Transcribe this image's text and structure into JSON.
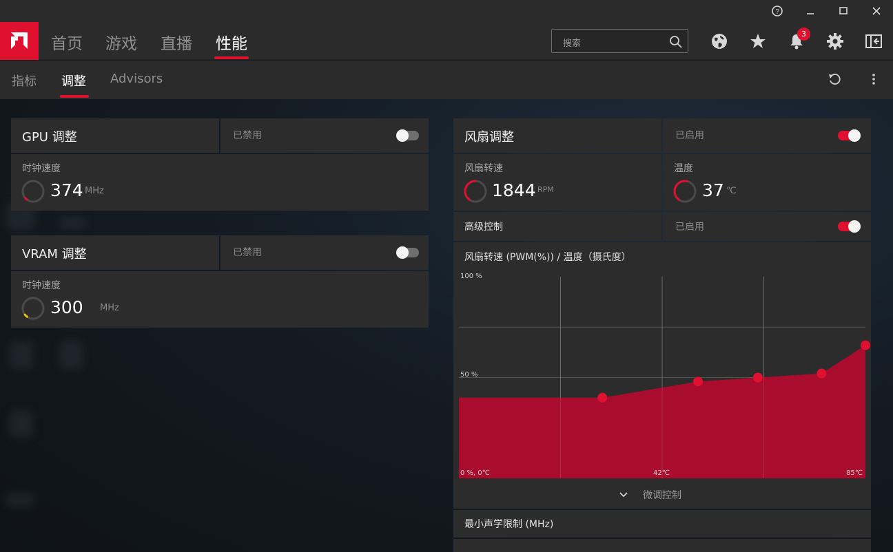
{
  "window": {
    "help_icon": "help-icon",
    "minimize_icon": "minimize-icon",
    "maximize_icon": "maximize-icon",
    "close_icon": "close-icon"
  },
  "nav": {
    "logo": "amd-logo",
    "tabs": [
      {
        "label": "首页"
      },
      {
        "label": "游戏"
      },
      {
        "label": "直播"
      },
      {
        "label": "性能",
        "active": true
      }
    ],
    "search_placeholder": "搜索",
    "notification_count": "3",
    "icons": [
      "globe-icon",
      "star-icon",
      "bell-icon",
      "gear-icon",
      "sidebar-toggle-icon"
    ]
  },
  "subnav": {
    "tabs": [
      {
        "label": "指标"
      },
      {
        "label": "调整",
        "active": true
      },
      {
        "label": "Advisors"
      }
    ]
  },
  "gpu": {
    "title": "GPU 调整",
    "status": "已禁用",
    "enabled": false,
    "clock_label": "时钟速度",
    "clock_value": "374",
    "clock_unit": "MHz",
    "gauge_fraction": 0.05
  },
  "vram": {
    "title": "VRAM 调整",
    "status": "已禁用",
    "enabled": false,
    "clock_label": "时钟速度",
    "clock_value": "300",
    "clock_unit": "MHz",
    "gauge_fraction": 0.06
  },
  "fan": {
    "title": "风扇调整",
    "status": "已启用",
    "enabled": true,
    "speed_label": "风扇转速",
    "speed_value": "1844",
    "speed_unit": "RPM",
    "speed_gauge_fraction": 0.5,
    "temp_label": "温度",
    "temp_value": "37",
    "temp_unit": "℃",
    "temp_gauge_fraction": 0.55,
    "advanced_label": "高级控制",
    "advanced_status": "已启用",
    "advanced_enabled": true,
    "chart_title": "风扇转速 (PWM(%)) / 温度（摄氏度）",
    "fine_tune_label": "微调控制",
    "acoustic_label": "最小声学限制 (MHz)"
  },
  "colors": {
    "accent": "#e0102f",
    "fill": "#b00b2c",
    "gauge_yellow": "#f2c200"
  },
  "chart_data": {
    "type": "area",
    "title": "风扇转速 (PWM(%)) / 温度（摄氏度）",
    "xlabel": "温度",
    "ylabel": "PWM(%)",
    "xlim": [
      0,
      85
    ],
    "ylim": [
      0,
      100
    ],
    "x_ticks": [
      "0 %, 0℃",
      "42℃",
      "85℃"
    ],
    "y_ticks": [
      "100 %",
      "50 %"
    ],
    "grid": true,
    "points": [
      {
        "x": 0,
        "y": 40
      },
      {
        "x": 36,
        "y": 40
      },
      {
        "x": 60,
        "y": 48
      },
      {
        "x": 75,
        "y": 50
      },
      {
        "x": 91,
        "y": 52
      },
      {
        "x": 102,
        "y": 66
      }
    ],
    "markers": [
      {
        "x": 36,
        "y": 40
      },
      {
        "x": 60,
        "y": 48
      },
      {
        "x": 75,
        "y": 50
      },
      {
        "x": 91,
        "y": 52
      },
      {
        "x": 102,
        "y": 66
      }
    ]
  }
}
